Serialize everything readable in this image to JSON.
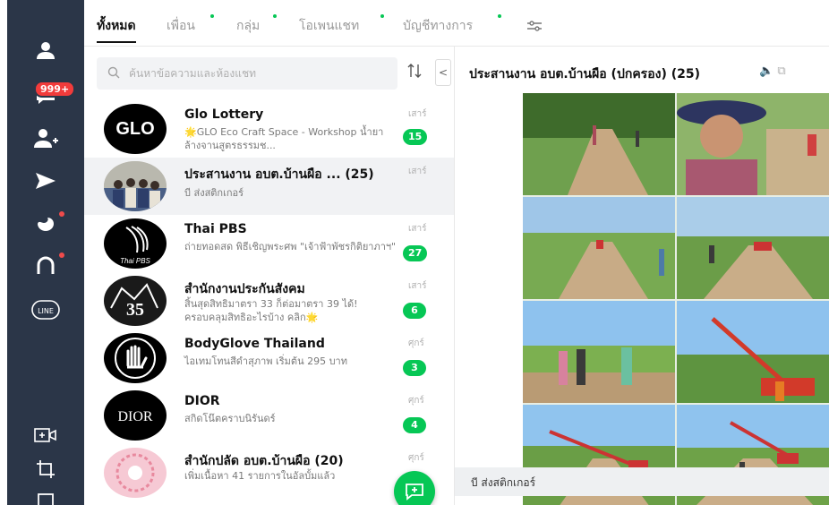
{
  "sidebar": {
    "unread_badge": "999+",
    "icons": [
      "profile-icon",
      "chats-icon",
      "add-friend-icon",
      "timeline-icon",
      "today-icon",
      "openchat-icon",
      "line-icon",
      "video-call-icon",
      "crop-icon",
      "more-icon"
    ]
  },
  "tabs": [
    {
      "label": "ทั้งหมด"
    },
    {
      "label": "เพื่อน"
    },
    {
      "label": "กลุ่ม"
    },
    {
      "label": "โอเพนแชท"
    },
    {
      "label": "บัญชีทางการ"
    }
  ],
  "search": {
    "placeholder": "ค้นหาข้อความและห้องแชท"
  },
  "collapse_label": "<",
  "chats": [
    {
      "title": "Glo Lottery",
      "preview": "🌟GLO Eco Craft Space - Workshop น้ำยาล้างจานสูตรธรรมช...",
      "time": "เสาร์",
      "unread": "15",
      "avatar_text": "GLO"
    },
    {
      "title": "ประสานงาน อบต.บ้านผือ ... (25)",
      "preview": "บี ส่งสติกเกอร์",
      "time": "เสาร์",
      "unread": "",
      "avatar_text": ""
    },
    {
      "title": "Thai PBS",
      "preview": "ถ่ายทอดสด พิธีเชิญพระศพ \"เจ้าฟ้าพัชรกิติยาภาฯ\"",
      "time": "เสาร์",
      "unread": "27",
      "avatar_text": "Thai PBS"
    },
    {
      "title": "สำนักงานประกันสังคม",
      "preview": "สิ้นสุดสิทธิมาตรา 33 ก็ต่อมาตรา 39 ได้! ครอบคลุมสิทธิอะไรบ้าง คลิก🌟",
      "time": "เสาร์",
      "unread": "6",
      "avatar_text": "35"
    },
    {
      "title": "BodyGlove Thailand",
      "preview": "ไอเทมโทนสีดำสุภาพ เริ่มต้น 295 บาท",
      "time": "ศุกร์",
      "unread": "3",
      "avatar_text": ""
    },
    {
      "title": "DIOR",
      "preview": "สกิดโน๊ตคราบนิรันดร์",
      "time": "ศุกร์",
      "unread": "4",
      "avatar_text": "DIOR"
    },
    {
      "title": "สำนักปลัด อบต.บ้านผือ (20)",
      "preview": "เพิ่มเนื้อหา 41 รายการในอัลบั้มแล้ว",
      "time": "ศุกร์",
      "unread": "",
      "avatar_text": ""
    }
  ],
  "room": {
    "title": "ประสานงาน อบต.บ้านผือ (ปกครอง) (25)",
    "photo_count": 8,
    "sender": "บี ส่งสติกเกอร์"
  },
  "colors": {
    "rail": "#2b3648",
    "accent": "#06c755",
    "badge": "#f23b3b"
  }
}
